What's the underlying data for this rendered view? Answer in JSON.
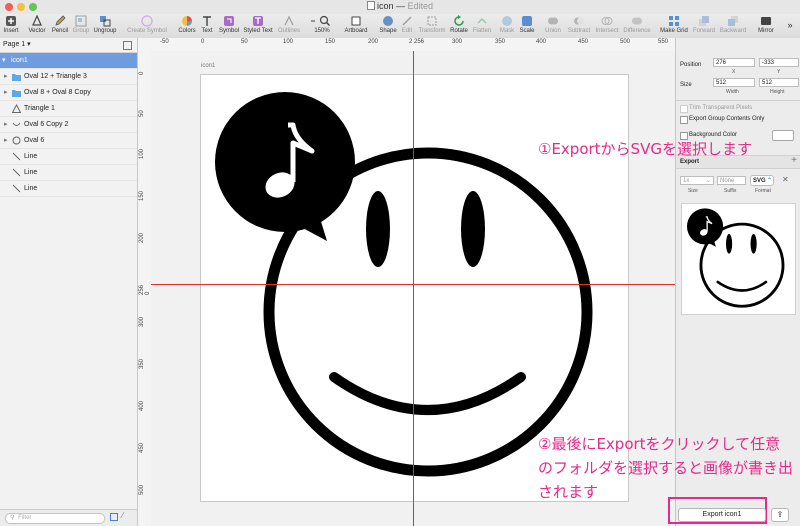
{
  "window": {
    "title": "icon",
    "status": "Edited"
  },
  "toolbar": [
    {
      "key": "insert",
      "label": "Insert",
      "icon": "insert-icon"
    },
    {
      "key": "vector",
      "label": "Vector",
      "icon": "vector-pen-icon"
    },
    {
      "key": "pencil",
      "label": "Pencil",
      "icon": "pencil-icon"
    },
    {
      "key": "group",
      "label": "Group",
      "icon": "group-icon"
    },
    {
      "key": "ungroup",
      "label": "Ungroup",
      "icon": "ungroup-icon"
    },
    {
      "key": "create_symbol",
      "label": "Create Symbol",
      "icon": "create-symbol-icon"
    },
    {
      "key": "colors",
      "label": "Colors",
      "icon": "colors-icon"
    },
    {
      "key": "text",
      "label": "Text",
      "icon": "text-icon"
    },
    {
      "key": "symbol",
      "label": "Symbol",
      "icon": "symbol-icon"
    },
    {
      "key": "styled_text",
      "label": "Styled Text",
      "icon": "styled-text-icon"
    },
    {
      "key": "outlines",
      "label": "Outlines",
      "icon": "outlines-icon"
    },
    {
      "key": "zoom",
      "label": "150%",
      "icon": "zoom-icon"
    },
    {
      "key": "artboard",
      "label": "Artboard",
      "icon": "artboard-icon"
    },
    {
      "key": "shape",
      "label": "Shape",
      "icon": "shape-icon"
    },
    {
      "key": "edit",
      "label": "Edit",
      "icon": "edit-icon"
    },
    {
      "key": "transform",
      "label": "Transform",
      "icon": "transform-icon"
    },
    {
      "key": "rotate",
      "label": "Rotate",
      "icon": "rotate-icon"
    },
    {
      "key": "flatten",
      "label": "Flatten",
      "icon": "flatten-icon"
    },
    {
      "key": "mask",
      "label": "Mask",
      "icon": "mask-icon"
    },
    {
      "key": "scale",
      "label": "Scale",
      "icon": "scale-icon"
    },
    {
      "key": "union",
      "label": "Union",
      "icon": "union-icon"
    },
    {
      "key": "subtract",
      "label": "Subtract",
      "icon": "subtract-icon"
    },
    {
      "key": "intersect",
      "label": "Intersect",
      "icon": "intersect-icon"
    },
    {
      "key": "difference",
      "label": "Difference",
      "icon": "difference-icon"
    },
    {
      "key": "make_grid",
      "label": "Make Grid",
      "icon": "make-grid-icon"
    },
    {
      "key": "forward",
      "label": "Forward",
      "icon": "forward-icon"
    },
    {
      "key": "backward",
      "label": "Backward",
      "icon": "backward-icon"
    },
    {
      "key": "mirror",
      "label": "Mirror",
      "icon": "mirror-icon"
    }
  ],
  "layers": {
    "page": "Page 1",
    "items": [
      {
        "name": "icon1",
        "kind": "artboard",
        "selected": true
      },
      {
        "name": "Oval 12 + Triangle 3",
        "kind": "folder"
      },
      {
        "name": "Oval 8 + Oval 8 Copy",
        "kind": "folder"
      },
      {
        "name": "Triangle 1",
        "kind": "triangle"
      },
      {
        "name": "Oval 6 Copy 2",
        "kind": "arc"
      },
      {
        "name": "Oval 6",
        "kind": "oval"
      },
      {
        "name": "Line",
        "kind": "line"
      },
      {
        "name": "Line",
        "kind": "line"
      },
      {
        "name": "Line",
        "kind": "line"
      }
    ],
    "filter_placeholder": "Filter"
  },
  "rulers": {
    "h_ticks": [
      "-50",
      "0",
      "50",
      "100",
      "150",
      "200",
      "2 256",
      "300",
      "350",
      "400",
      "450",
      "500",
      "550"
    ],
    "v_ticks": [
      "0",
      "50",
      "100",
      "150",
      "200",
      "256 0",
      "300",
      "350",
      "400",
      "450",
      "500"
    ]
  },
  "artboard": {
    "name": "icon1"
  },
  "inspector": {
    "position_label": "Position",
    "x": "276",
    "y": "-333",
    "x_label": "X",
    "y_label": "Y",
    "size_label": "Size",
    "width": "512",
    "height": "512",
    "width_label": "Width",
    "height_label": "Height",
    "trim_label": "Trim Transparent Pixels",
    "export_group_label": "Export Group Contents Only",
    "background_label": "Background Color",
    "export_section": "Export",
    "export_size": "1x",
    "export_suffix": "None",
    "export_format": "SVG",
    "size_col": "Size",
    "suffix_col": "Suffix",
    "format_col": "Format",
    "export_button": "Export icon1"
  },
  "annotations": {
    "note1": "①ExportからSVGを選択します",
    "note2_line1": "②最後にExportをクリックして任意",
    "note2_line2": "のフォルダを選択すると画像が書き出",
    "note2_line3": "されます",
    "color": "#e42a8a"
  },
  "colors": {
    "selection": "#6e9cde",
    "guide": "#e0302a",
    "accent": "#e42a8a"
  }
}
